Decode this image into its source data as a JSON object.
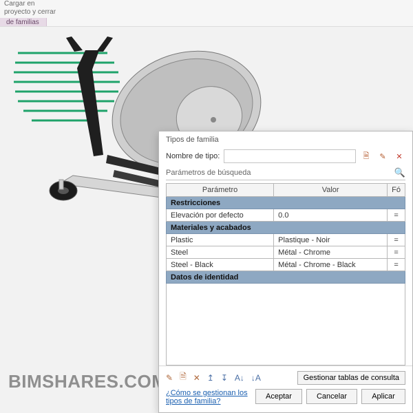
{
  "ribbon": {
    "load_label_line1": "Cargar en",
    "load_label_line2": "proyecto y cerrar",
    "panel_label": "de familias"
  },
  "watermark": "BIMSHARES.COM",
  "dialog": {
    "title": "Tipos de familia",
    "name_label": "Nombre de tipo:",
    "name_value": "",
    "search_placeholder": "Parámetros de búsqueda",
    "headers": {
      "param": "Parámetro",
      "value": "Valor",
      "formula": "Fó"
    },
    "groups": {
      "restrictions": "Restricciones",
      "materials": "Materiales y acabados",
      "identity": "Datos de identidad"
    },
    "rows": {
      "elevation": {
        "param": "Elevación por defecto",
        "value": "0.0"
      },
      "plastic": {
        "param": "Plastic",
        "value": "Plastique - Noir"
      },
      "steel": {
        "param": "Steel",
        "value": "Métal - Chrome"
      },
      "steelblk": {
        "param": "Steel - Black",
        "value": "Métal - Chrome - Black"
      }
    },
    "manage_label": "Gestionar tablas de consulta",
    "help_link": "¿Cómo se gestionan los tipos de familia?",
    "buttons": {
      "ok": "Aceptar",
      "cancel": "Cancelar",
      "apply": "Aplicar"
    }
  },
  "icons": {
    "new_type": "🗎",
    "rename": "✎",
    "delete": "✕",
    "search": "🔍",
    "pencil": "✎",
    "new_param": "🗎",
    "del_param": "✕",
    "up": "↥",
    "down": "↧",
    "sort_asc": "A↓",
    "sort_desc": "↓A"
  }
}
